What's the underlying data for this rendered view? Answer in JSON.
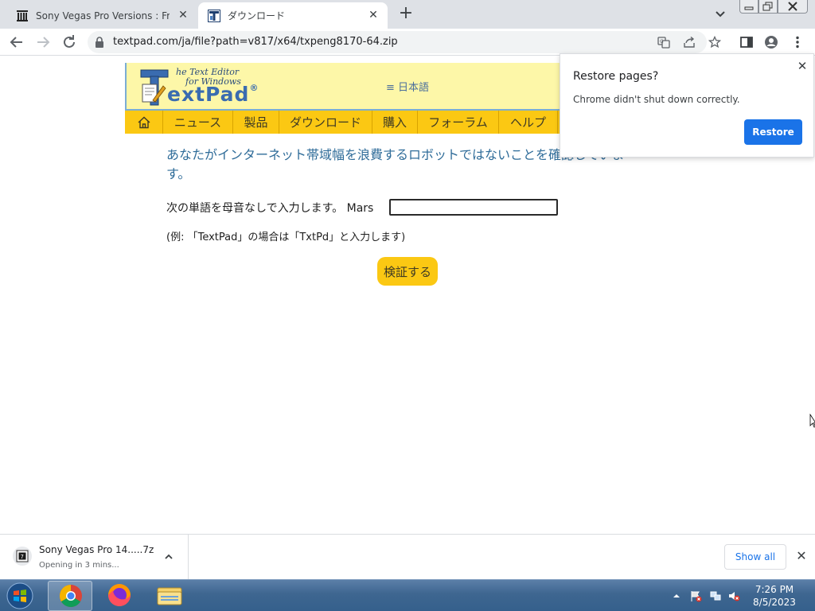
{
  "browser": {
    "tabs": [
      {
        "title": "Sony Vegas Pro Versions : Free D",
        "favicon": "archive-building-icon",
        "active": false
      },
      {
        "title": "ダウンロード",
        "favicon": "textpad-icon",
        "active": true
      }
    ],
    "address_bar": {
      "url": "textpad.com/ja/file?path=v817/x64/txpeng8170-64.zip",
      "secure": true
    }
  },
  "site": {
    "logo": {
      "tagline_line1": "he Text Editor",
      "tagline_line2": "for Windows",
      "brand": "extPad",
      "registered": "®"
    },
    "language_link": "≡ 日本語",
    "nav": [
      "ニュース",
      "製品",
      "ダウンロード",
      "購入",
      "フォーラム",
      "ヘルプ"
    ]
  },
  "verification": {
    "message": "あなたがインターネット帯域幅を浪費するロボットではないことを確認しています。",
    "prompt": "次の単語を母音なしで入力します。 Mars",
    "input_value": "",
    "example": "(例: 「TextPad」の場合は「TxtPd」と入力します)",
    "submit_label": "検証する"
  },
  "restore_popup": {
    "title": "Restore pages?",
    "text": "Chrome didn't shut down correctly.",
    "button": "Restore"
  },
  "downloads": {
    "item_name": "Sony Vegas Pro 14.....7z",
    "item_status": "Opening in 3 mins...",
    "show_all": "Show all"
  },
  "taskbar": {
    "apps": [
      "chrome-icon",
      "firefox-icon",
      "file-explorer-icon"
    ],
    "time": "7:26 PM",
    "date": "8/5/2023"
  },
  "colors": {
    "accent_blue": "#1a73e8",
    "textpad_yellow": "#fbc813",
    "textpad_header": "#fdf7a8",
    "message_blue": "#2f6c99"
  }
}
